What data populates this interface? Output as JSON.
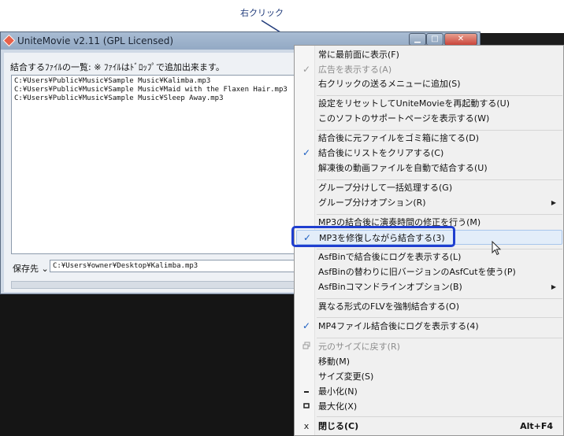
{
  "annotation": {
    "callout_text": "右クリック"
  },
  "window": {
    "title": "UniteMovie v2.11 (GPL Licensed)",
    "controls": {
      "minimize": "▁",
      "maximize": "□",
      "close": "✕"
    }
  },
  "main": {
    "list_label": "結合するﾌｧｲﾙの一覧: ※ ﾌｧｲﾙはﾄﾞﾛｯﾌﾟで追加出来ます。",
    "files": [
      "C:¥Users¥Public¥Music¥Sample Music¥Kalimba.mp3",
      "C:¥Users¥Public¥Music¥Sample Music¥Maid with the Flaxen Hair.mp3",
      "C:¥Users¥Public¥Music¥Sample Music¥Sleep Away.mp3"
    ],
    "destination_label": "保存先 ⌄",
    "destination_value": "C:¥Users¥owner¥Desktop¥Kalimba.mp3"
  },
  "context_menu": {
    "check_glyph": "✓",
    "submenu_glyph": "▶",
    "items": [
      {
        "label": "常に最前面に表示(F)"
      },
      {
        "label": "広告を表示する(A)",
        "checked": true,
        "disabled": true
      },
      {
        "label": "右クリックの送るメニューに追加(S)"
      },
      {
        "label": "設定をリセットしてUniteMovieを再起動する(U)"
      },
      {
        "label": "このソフトのサポートページを表示する(W)"
      },
      {
        "label": "結合後に元ファイルをゴミ箱に捨てる(D)"
      },
      {
        "label": "結合後にリストをクリアする(C)",
        "checked": true
      },
      {
        "label": "解凍後の動画ファイルを自動で結合する(U)"
      },
      {
        "label": "グループ分けして一括処理する(G)"
      },
      {
        "label": "グループ分けオプション(R)",
        "submenu": true
      },
      {
        "label": "MP3の結合後に演奏時間の修正を行う(M)"
      },
      {
        "label": "MP3を修復しながら結合する(3)",
        "checked": true,
        "highlighted": true
      },
      {
        "label": "AsfBinで結合後にログを表示する(L)"
      },
      {
        "label": "AsfBinの替わりに旧バージョンのAsfCutを使う(P)"
      },
      {
        "label": "AsfBinコマンドラインオプション(B)",
        "submenu": true
      },
      {
        "label": "異なる形式のFLVを強制結合する(O)"
      },
      {
        "label": "MP4ファイル結合後にログを表示する(4)",
        "checked": true
      },
      {
        "label": "元のサイズに戻す(R)",
        "disabled": true,
        "icon": "restore-icon"
      },
      {
        "label": "移動(M)"
      },
      {
        "label": "サイズ変更(S)"
      },
      {
        "label": "最小化(N)",
        "icon": "minimize-icon"
      },
      {
        "label": "最大化(X)",
        "icon": "maximize-icon"
      },
      {
        "label": "閉じる(C)",
        "bold": true,
        "icon": "close-icon",
        "accelerator": "Alt+F4"
      }
    ]
  },
  "colors": {
    "highlight_border": "#1f3fd0",
    "check": "#1d5fc2",
    "callout": "#1f3a7a"
  }
}
